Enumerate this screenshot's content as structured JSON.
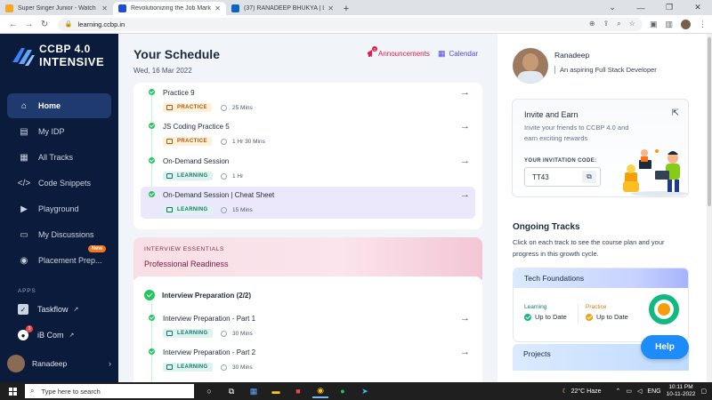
{
  "browser": {
    "tabs": [
      {
        "title": "Super Singer Junior - Watch Epis",
        "favicon_color": "#f5a623",
        "active": false
      },
      {
        "title": "Revolutionizing the Job Market |",
        "favicon_color": "#1d4ed8",
        "active": true
      },
      {
        "title": "(37) RANADEEP BHUKYA | LinkedIn",
        "favicon_color": "#0a66c2",
        "active": false
      }
    ],
    "new_tab": "+",
    "url": "learning.ccbp.in"
  },
  "sidebar": {
    "logo_line1": "CCBP 4.0",
    "logo_line2": "INTENSIVE",
    "items": [
      {
        "label": "Home",
        "icon": "home-icon",
        "active": true
      },
      {
        "label": "My IDP",
        "icon": "document-icon",
        "active": false
      },
      {
        "label": "All Tracks",
        "icon": "book-icon",
        "active": false
      },
      {
        "label": "Code Snippets",
        "icon": "code-icon",
        "active": false
      },
      {
        "label": "Playground",
        "icon": "terminal-icon",
        "active": false
      },
      {
        "label": "My Discussions",
        "icon": "chat-icon",
        "active": false
      },
      {
        "label": "Placement Prep...",
        "icon": "briefcase-icon",
        "active": false,
        "badge": "New"
      }
    ],
    "apps_label": "APPS",
    "apps": [
      {
        "label": "Taskflow",
        "icon": "check-square-icon"
      },
      {
        "label": "iB Com",
        "icon": "chat-bubble-icon",
        "badge": "3"
      }
    ],
    "user_name": "Ranadeep"
  },
  "schedule": {
    "title": "Your Schedule",
    "date": "Wed, 16 Mar 2022",
    "announcements_label": "Announcements",
    "announcements_badge": "1",
    "calendar_label": "Calendar",
    "sessions": [
      {
        "title": "Practice 9",
        "tag": "PRACTICE",
        "duration": "25 Mins",
        "highlighted": false
      },
      {
        "title": "JS Coding Practice 5",
        "tag": "PRACTICE",
        "duration": "1 Hr 30 Mins",
        "highlighted": false
      },
      {
        "title": "On-Demand Session",
        "tag": "LEARNING",
        "duration": "1 Hr",
        "highlighted": false
      },
      {
        "title": "On-Demand Session | Cheat Sheet",
        "tag": "LEARNING",
        "duration": "15 Mins",
        "highlighted": true
      }
    ],
    "interview": {
      "label": "INTERVIEW ESSENTIALS",
      "title": "Professional Readiness",
      "group_title": "Interview Preparation (2/2)",
      "sessions": [
        {
          "title": "Interview Preparation - Part 1",
          "tag": "LEARNING",
          "duration": "30 Mins"
        },
        {
          "title": "Interview Preparation - Part 2",
          "tag": "LEARNING",
          "duration": "30 Mins"
        }
      ]
    }
  },
  "profile": {
    "name": "Ranadeep",
    "role": "An aspiring Full Stack Developer"
  },
  "invite": {
    "title": "Invite and Earn",
    "description": "Invite your friends to CCBP 4.0 and earn exciting rewards",
    "code_label": "YOUR INVITATION CODE:",
    "code": "TT43"
  },
  "ongoing": {
    "title": "Ongoing Tracks",
    "description": "Click on each track to see the course plan and your progress in this growth cycle.",
    "tracks": [
      {
        "name": "Tech Foundations",
        "learning_label": "Learning",
        "learning_value": "Up to Date",
        "practice_label": "Practice",
        "practice_value": "Up to Date"
      },
      {
        "name": "Projects"
      }
    ]
  },
  "help_label": "Help",
  "taskbar": {
    "search_placeholder": "Type here to search",
    "weather": "22°C  Haze",
    "language": "ENG",
    "time": "10:11 PM",
    "date": "10-11-2022"
  },
  "colors": {
    "sidebar_bg": "#0b1b3b",
    "sidebar_active": "#1e3a6e",
    "accent_blue": "#1d8cf8",
    "practice_tag": "#b45309",
    "learning_tag": "#0f766e",
    "success_green": "#22c55e",
    "announcement_red": "#e11d48",
    "calendar_indigo": "#4f46e5"
  }
}
